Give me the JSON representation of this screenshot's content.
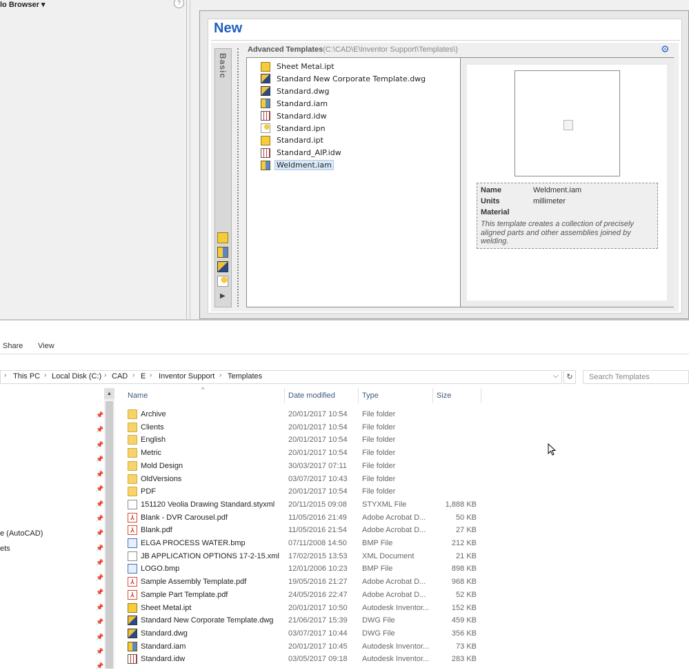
{
  "left_panel": {
    "title": "lo Browser ▾",
    "help": "?"
  },
  "dialog": {
    "title": "New",
    "tab_label": "Basic",
    "advanced_title": "Advanced Templates",
    "advanced_path": "(C:\\CAD\\E\\Inventor Support\\Templates\\)",
    "templates": [
      {
        "name": "Sheet Metal.ipt",
        "icon": "ipt"
      },
      {
        "name": "Standard New Corporate Template.dwg",
        "icon": "dwg"
      },
      {
        "name": "Standard.dwg",
        "icon": "dwg"
      },
      {
        "name": "Standard.iam",
        "icon": "iam"
      },
      {
        "name": "Standard.idw",
        "icon": "idw"
      },
      {
        "name": "Standard.ipn",
        "icon": "ipn"
      },
      {
        "name": "Standard.ipt",
        "icon": "ipt"
      },
      {
        "name": "Standard_AIP.idw",
        "icon": "idw"
      },
      {
        "name": "Weldment.iam",
        "icon": "iam",
        "selected": true
      }
    ],
    "properties": {
      "name_label": "Name",
      "name_value": "Weldment.iam",
      "units_label": "Units",
      "units_value": "millimeter",
      "material_label": "Material",
      "description": "This template creates a collection of precisely aligned parts and other assemblies joined by welding."
    }
  },
  "explorer": {
    "ribbon_tabs": [
      "Share",
      "View"
    ],
    "breadcrumbs": [
      "This PC",
      "Local Disk (C:)",
      "CAD",
      "E",
      "Inventor Support",
      "Templates"
    ],
    "search_placeholder": "Search Templates",
    "nav_items": [
      "e (AutoCAD)",
      "ets"
    ],
    "columns": [
      "Name",
      "Date modified",
      "Type",
      "Size"
    ],
    "files": [
      {
        "name": "Archive",
        "date": "20/01/2017 10:54",
        "type": "File folder",
        "size": "",
        "icon": "folder"
      },
      {
        "name": "Clients",
        "date": "20/01/2017 10:54",
        "type": "File folder",
        "size": "",
        "icon": "folder"
      },
      {
        "name": "English",
        "date": "20/01/2017 10:54",
        "type": "File folder",
        "size": "",
        "icon": "folder"
      },
      {
        "name": "Metric",
        "date": "20/01/2017 10:54",
        "type": "File folder",
        "size": "",
        "icon": "folder"
      },
      {
        "name": "Mold Design",
        "date": "30/03/2017 07:11",
        "type": "File folder",
        "size": "",
        "icon": "folder"
      },
      {
        "name": "OldVersions",
        "date": "03/07/2017 10:43",
        "type": "File folder",
        "size": "",
        "icon": "folder"
      },
      {
        "name": "PDF",
        "date": "20/01/2017 10:54",
        "type": "File folder",
        "size": "",
        "icon": "folder"
      },
      {
        "name": "151120 Veolia Drawing Standard.styxml",
        "date": "20/11/2015 09:08",
        "type": "STYXML File",
        "size": "1,888 KB",
        "icon": "doc"
      },
      {
        "name": "Blank - DVR Carousel.pdf",
        "date": "11/05/2016 21:49",
        "type": "Adobe Acrobat D...",
        "size": "50 KB",
        "icon": "pdf"
      },
      {
        "name": "Blank.pdf",
        "date": "11/05/2016 21:54",
        "type": "Adobe Acrobat D...",
        "size": "27 KB",
        "icon": "pdf"
      },
      {
        "name": "ELGA PROCESS WATER.bmp",
        "date": "07/11/2008 14:50",
        "type": "BMP File",
        "size": "212 KB",
        "icon": "bmp"
      },
      {
        "name": "JB APPLICATION OPTIONS 17-2-15.xml",
        "date": "17/02/2015 13:53",
        "type": "XML Document",
        "size": "21 KB",
        "icon": "doc"
      },
      {
        "name": "LOGO.bmp",
        "date": "12/01/2006 10:23",
        "type": "BMP File",
        "size": "898 KB",
        "icon": "bmp"
      },
      {
        "name": "Sample Assembly Template.pdf",
        "date": "19/05/2016 21:27",
        "type": "Adobe Acrobat D...",
        "size": "968 KB",
        "icon": "pdf"
      },
      {
        "name": "Sample Part Template.pdf",
        "date": "24/05/2016 22:47",
        "type": "Adobe Acrobat D...",
        "size": "52 KB",
        "icon": "pdf"
      },
      {
        "name": "Sheet Metal.ipt",
        "date": "20/01/2017 10:50",
        "type": "Autodesk Inventor...",
        "size": "152 KB",
        "icon": "ipt"
      },
      {
        "name": "Standard New Corporate Template.dwg",
        "date": "21/06/2017 15:39",
        "type": "DWG File",
        "size": "459 KB",
        "icon": "dwg"
      },
      {
        "name": "Standard.dwg",
        "date": "03/07/2017 10:44",
        "type": "DWG File",
        "size": "356 KB",
        "icon": "dwg"
      },
      {
        "name": "Standard.iam",
        "date": "20/01/2017 10:45",
        "type": "Autodesk Inventor...",
        "size": "73 KB",
        "icon": "iam"
      },
      {
        "name": "Standard.idw",
        "date": "03/05/2017 09:18",
        "type": "Autodesk Inventor...",
        "size": "283 KB",
        "icon": "idw"
      }
    ]
  }
}
